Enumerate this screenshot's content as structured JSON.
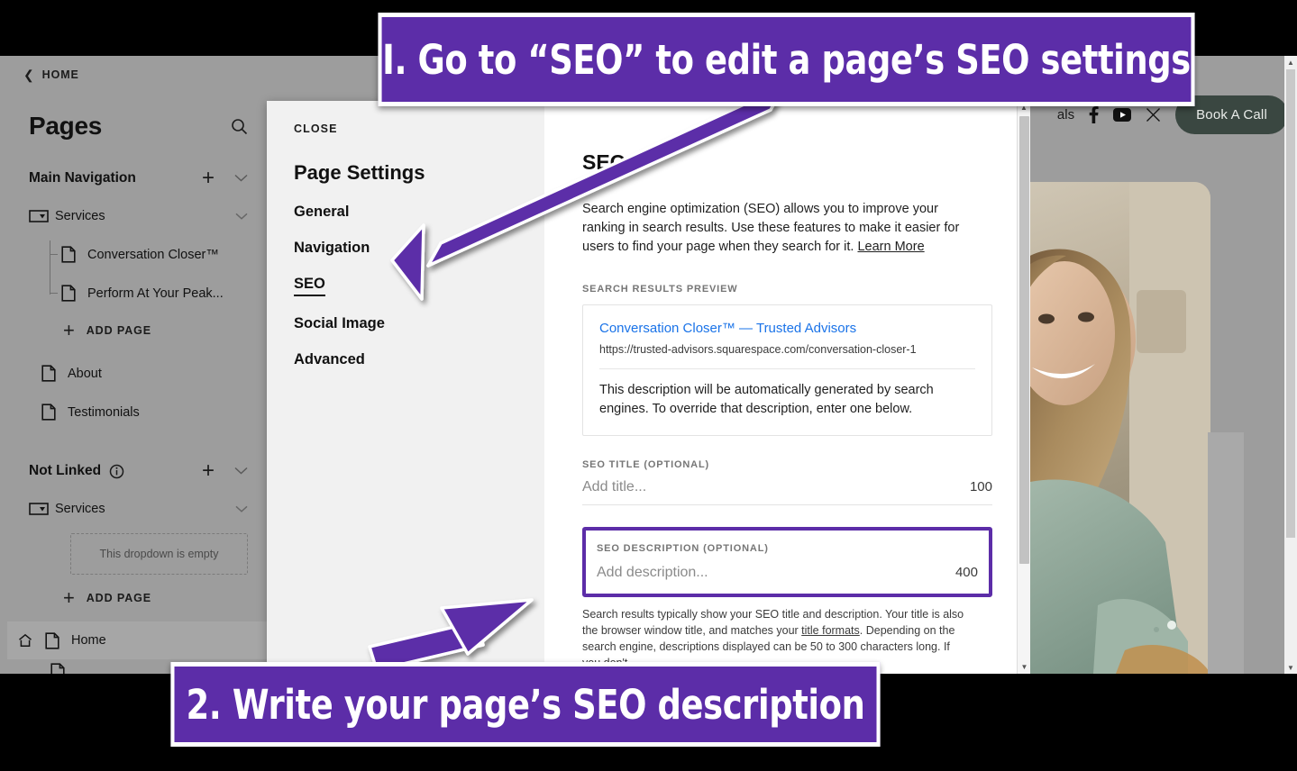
{
  "annotations": {
    "step1": "I.  Go to “SEO” to edit a page’s SEO settings",
    "step2": "2. Write your page’s SEO description",
    "accent_color": "#5C2DA8",
    "arrow1_name": "arrow-pointing-to-seo-tab",
    "arrow2_name": "arrow-pointing-to-seo-description-field"
  },
  "sidebar": {
    "back_label": "HOME",
    "title": "Pages",
    "search_icon": "search-icon",
    "sections": [
      {
        "title": "Main Navigation",
        "add_label": "+",
        "collapse_icon": "chevron-down-icon",
        "items": [
          {
            "label": "Services",
            "icon": "dropdown-folder-icon",
            "type": "folder",
            "chevron": "chevron-down-icon"
          },
          {
            "label": "Conversation Closer™",
            "icon": "page-icon",
            "type": "child"
          },
          {
            "label": "Perform At Your Peak...",
            "icon": "page-icon",
            "type": "child"
          }
        ],
        "add_page_label": "ADD PAGE",
        "pages": [
          {
            "label": "About",
            "icon": "page-icon"
          },
          {
            "label": "Testimonials",
            "icon": "page-icon"
          }
        ]
      },
      {
        "title": "Not Linked",
        "info_icon": "info-icon",
        "add_label": "+",
        "collapse_icon": "chevron-down-icon",
        "items": [
          {
            "label": "Services",
            "icon": "dropdown-folder-icon",
            "type": "folder",
            "chevron": "chevron-down-icon"
          }
        ],
        "empty_text": "This dropdown is empty",
        "add_page_label": "ADD PAGE"
      }
    ],
    "home_row": {
      "label": "Home",
      "home_icon": "home-icon",
      "page_icon": "page-icon"
    }
  },
  "settings": {
    "close_label": "CLOSE",
    "title": "Page Settings",
    "nav": [
      {
        "label": "General",
        "active": false
      },
      {
        "label": "Navigation",
        "active": false
      },
      {
        "label": "SEO",
        "active": true
      },
      {
        "label": "Social Image",
        "active": false
      },
      {
        "label": "Advanced",
        "active": false
      }
    ],
    "seo": {
      "heading": "SEO",
      "intro": "Search engine optimization (SEO) allows you to improve your ranking in search results. Use these features to make it easier for users to find your page when they search for it.",
      "intro_link": "Learn More",
      "preview_label": "SEARCH RESULTS PREVIEW",
      "preview": {
        "title": "Conversation Closer™ — Trusted Advisors",
        "url": "https://trusted-advisors.squarespace.com/conversation-closer-1",
        "body": "This description will be automatically generated by search engines. To override that description, enter one below."
      },
      "title_field": {
        "label": "SEO TITLE (OPTIONAL)",
        "placeholder": "Add title...",
        "count": "100"
      },
      "description_field": {
        "label": "SEO DESCRIPTION (OPTIONAL)",
        "placeholder": "Add description...",
        "count": "400"
      },
      "fine_print_1": "Search results typically show your SEO title and description. Your title is also the browser window title, and matches your ",
      "fine_print_link": "title formats",
      "fine_print_2": ". Depending on the search engine, descriptions displayed can be 50 to 300 characters long. If you don't"
    },
    "scrollbar": {
      "up_icon": "scroll-up-arrow-icon",
      "down_icon": "scroll-down-arrow-icon"
    }
  },
  "site_preview": {
    "nav_tail": "als",
    "social": [
      {
        "name": "facebook-icon"
      },
      {
        "name": "youtube-icon"
      },
      {
        "name": "x-twitter-icon"
      }
    ],
    "cta_label": "Book A Call",
    "cta_color": "#3A4741",
    "hero_alt": "smiling-woman-photo",
    "scrollbar": {
      "up_icon": "scroll-up-arrow-icon",
      "down_icon": "scroll-down-arrow-icon"
    }
  }
}
